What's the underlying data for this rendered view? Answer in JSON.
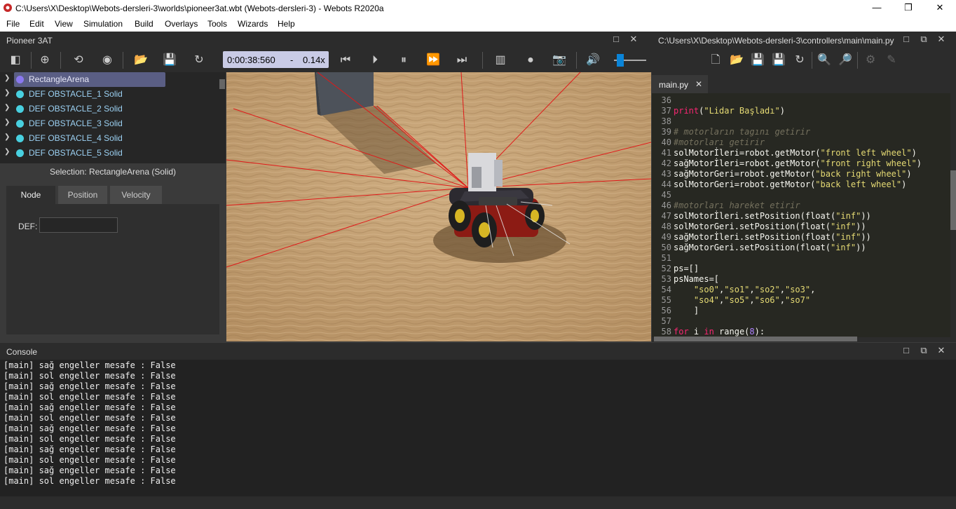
{
  "window": {
    "title": "C:\\Users\\X\\Desktop\\Webots-dersleri-3\\worlds\\pioneer3at.wbt (Webots-dersleri-3) - Webots R2020a",
    "minimize": "—",
    "restore": "❐",
    "close": "✕"
  },
  "menu": [
    "File",
    "Edit",
    "View",
    "Simulation",
    "Build",
    "Overlays",
    "Tools",
    "Wizards",
    "Help"
  ],
  "scene_panel": {
    "title": "Pioneer 3AT",
    "items": [
      {
        "label": "RectangleArena",
        "color": "#7b6cf0",
        "selected": true
      },
      {
        "label": "DEF OBSTACLE_1 Solid",
        "color": "#48d0e0"
      },
      {
        "label": "DEF OBSTACLE_2 Solid",
        "color": "#48d0e0"
      },
      {
        "label": "DEF OBSTACLE_3 Solid",
        "color": "#48d0e0"
      },
      {
        "label": "DEF OBSTACLE_4 Solid",
        "color": "#48d0e0"
      },
      {
        "label": "DEF OBSTACLE_5 Solid",
        "color": "#48d0e0"
      }
    ],
    "selection": "Selection: RectangleArena (Solid)",
    "tabs": [
      "Node",
      "Position",
      "Velocity"
    ],
    "def_label": "DEF:",
    "def_value": ""
  },
  "toolbar": {
    "time": "0:00:38:560",
    "dash": "-",
    "speed": "0.14x",
    "volume_level": 0.1
  },
  "editor": {
    "title": "C:\\Users\\X\\Desktop\\Webots-dersleri-3\\controllers\\main\\main.py",
    "tab": "main.py",
    "tab_close": "✕",
    "lines": [
      {
        "n": "36",
        "html": ""
      },
      {
        "n": "37",
        "html": "<span class='kw'>print</span>(<span class='st'>\"Lidar Başladı\"</span>)"
      },
      {
        "n": "38",
        "html": ""
      },
      {
        "n": "39",
        "html": "<span class='cm'># motorların tagını getirir</span>"
      },
      {
        "n": "40",
        "html": "<span class='cm'>#motorları getirir</span>"
      },
      {
        "n": "41",
        "html": "solMotorİleri=robot.getMotor(<span class='st'>\"front left wheel\"</span>)"
      },
      {
        "n": "42",
        "html": "sağMotorİleri=robot.getMotor(<span class='st'>\"front right wheel\"</span>)"
      },
      {
        "n": "43",
        "html": "sağMotorGeri=robot.getMotor(<span class='st'>\"back right wheel\"</span>)"
      },
      {
        "n": "44",
        "html": "solMotorGeri=robot.getMotor(<span class='st'>\"back left wheel\"</span>)"
      },
      {
        "n": "45",
        "html": ""
      },
      {
        "n": "46",
        "html": "<span class='cm'>#motorları hareket etirir</span>"
      },
      {
        "n": "47",
        "html": "solMotorİleri.setPosition(float(<span class='st'>\"inf\"</span>))"
      },
      {
        "n": "48",
        "html": "solMotorGeri.setPosition(float(<span class='st'>\"inf\"</span>))"
      },
      {
        "n": "49",
        "html": "sağMotorİleri.setPosition(float(<span class='st'>\"inf\"</span>))"
      },
      {
        "n": "50",
        "html": "sağMotorGeri.setPosition(float(<span class='st'>\"inf\"</span>))"
      },
      {
        "n": "51",
        "html": ""
      },
      {
        "n": "52",
        "html": "ps=[]"
      },
      {
        "n": "53",
        "html": "psNames=["
      },
      {
        "n": "54",
        "html": "    <span class='st'>\"so0\"</span>,<span class='st'>\"so1\"</span>,<span class='st'>\"so2\"</span>,<span class='st'>\"so3\"</span>,"
      },
      {
        "n": "55",
        "html": "    <span class='st'>\"so4\"</span>,<span class='st'>\"so5\"</span>,<span class='st'>\"so6\"</span>,<span class='st'>\"so7\"</span>"
      },
      {
        "n": "56",
        "html": "    ]"
      },
      {
        "n": "57",
        "html": ""
      },
      {
        "n": "58",
        "html": "<span class='kw'>for</span> i <span class='kw'>in</span> range(<span class='nu'>8</span>):"
      }
    ]
  },
  "console": {
    "title": "Console",
    "lines": [
      "[main] sağ engeller mesafe : False",
      "[main] sol engeller mesafe : False",
      "[main] sağ engeller mesafe : False",
      "[main] sol engeller mesafe : False",
      "[main] sağ engeller mesafe : False",
      "[main] sol engeller mesafe : False",
      "[main] sağ engeller mesafe : False",
      "[main] sol engeller mesafe : False",
      "[main] sağ engeller mesafe : False",
      "[main] sol engeller mesafe : False",
      "[main] sağ engeller mesafe : False",
      "[main] sol engeller mesafe : False"
    ]
  }
}
